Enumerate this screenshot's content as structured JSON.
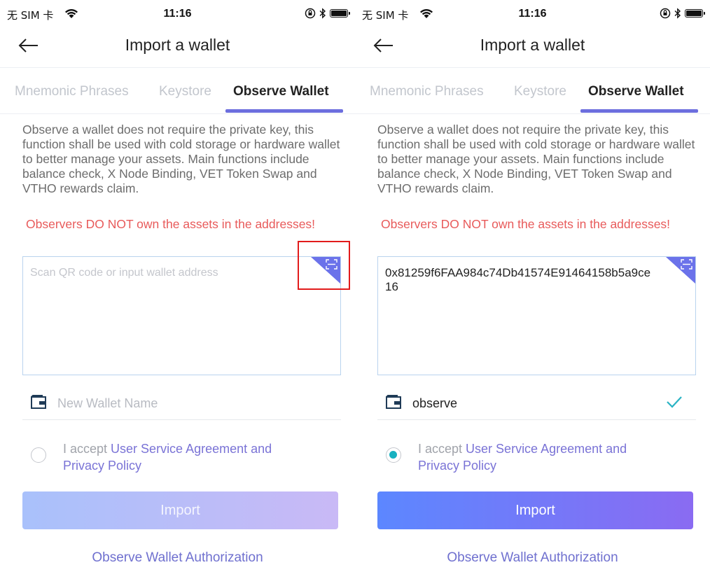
{
  "status_bar": {
    "carrier": "无 SIM 卡",
    "time": "11:16"
  },
  "nav": {
    "title": "Import a wallet"
  },
  "tabs": [
    {
      "label": "Mnemonic Phrases"
    },
    {
      "label": "Keystore"
    },
    {
      "label": "Observe Wallet"
    }
  ],
  "description": "Observe a wallet does not require the private key, this function shall be used with cold storage or hardware wallet to better manage your assets. Main functions include balance check, X Node Binding, VET Token Swap and VTHO rewards claim.",
  "warning": "Observers DO NOT own the assets in the addresses!",
  "left_screen": {
    "address_placeholder": "Scan QR code or input wallet address",
    "wallet_name_placeholder": "New Wallet Name",
    "agreement_checked": false
  },
  "right_screen": {
    "address_value": "0x81259f6FAA984c74Db41574E91464158b5a9ce16",
    "wallet_name": "observe",
    "agreement_checked": true
  },
  "agreement": {
    "prefix": "I accept ",
    "link": "User Service Agreement and Privacy Policy"
  },
  "import_label": "Import",
  "authorization_link": "Observe Wallet Authorization",
  "colors": {
    "accent": "#6c6ede",
    "warning": "#e85a5a",
    "link": "#7a73d6",
    "radio_on": "#17b1c0",
    "highlight_box": "#e21b1b"
  },
  "icons": {
    "back": "arrow-left",
    "scan": "scan-qr",
    "wallet": "wallet",
    "check": "checkmark"
  }
}
